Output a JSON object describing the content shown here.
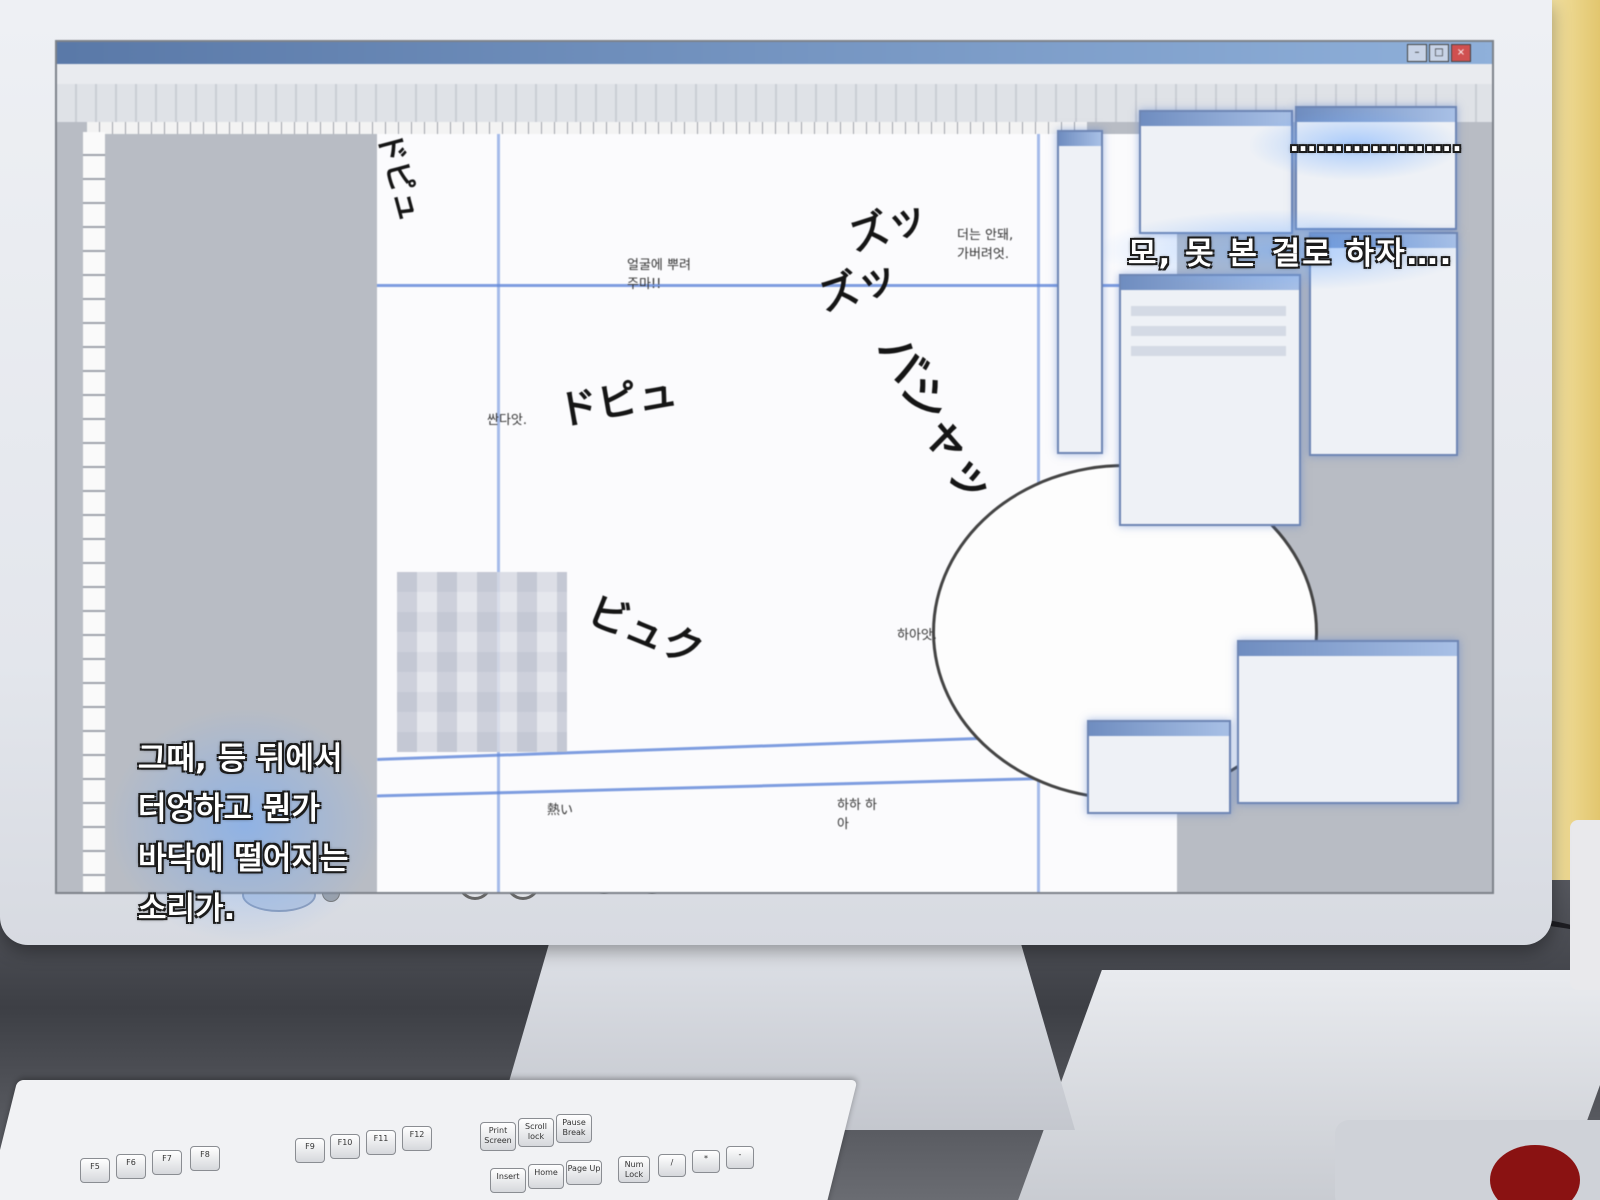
{
  "dialogue": {
    "top_line": "……………….",
    "main_line": "모, 못 본 걸로 하자….",
    "narration": [
      "그때, 등 뒤에서",
      "터엉하고 뭔가",
      "바닥에 떨어지는",
      "소리가."
    ]
  },
  "artwork": {
    "speech_bubbles": [
      "얼굴에 뿌려주마!!",
      "더는 안돼, 가버려엇.",
      "싼다앗.",
      "하아앗.",
      "하하 하아",
      "熱い"
    ],
    "sfx": [
      "ズッ",
      "ズッ",
      "ドピュ",
      "ビュク",
      "ドピュ",
      "バシャッ"
    ]
  },
  "keyboard": {
    "keys": [
      "F5",
      "F6",
      "F7",
      "F8",
      "F9",
      "F10",
      "F11",
      "F12",
      "Print Screen",
      "Scroll lock",
      "Pause Break",
      "Insert",
      "Home",
      "Page Up",
      "Num Lock",
      "/",
      "*",
      "-"
    ]
  },
  "colors": {
    "subtitle_glow": "#6eaaff",
    "guide_line": "#5f86d8",
    "panel_border": "#6e86b4"
  }
}
